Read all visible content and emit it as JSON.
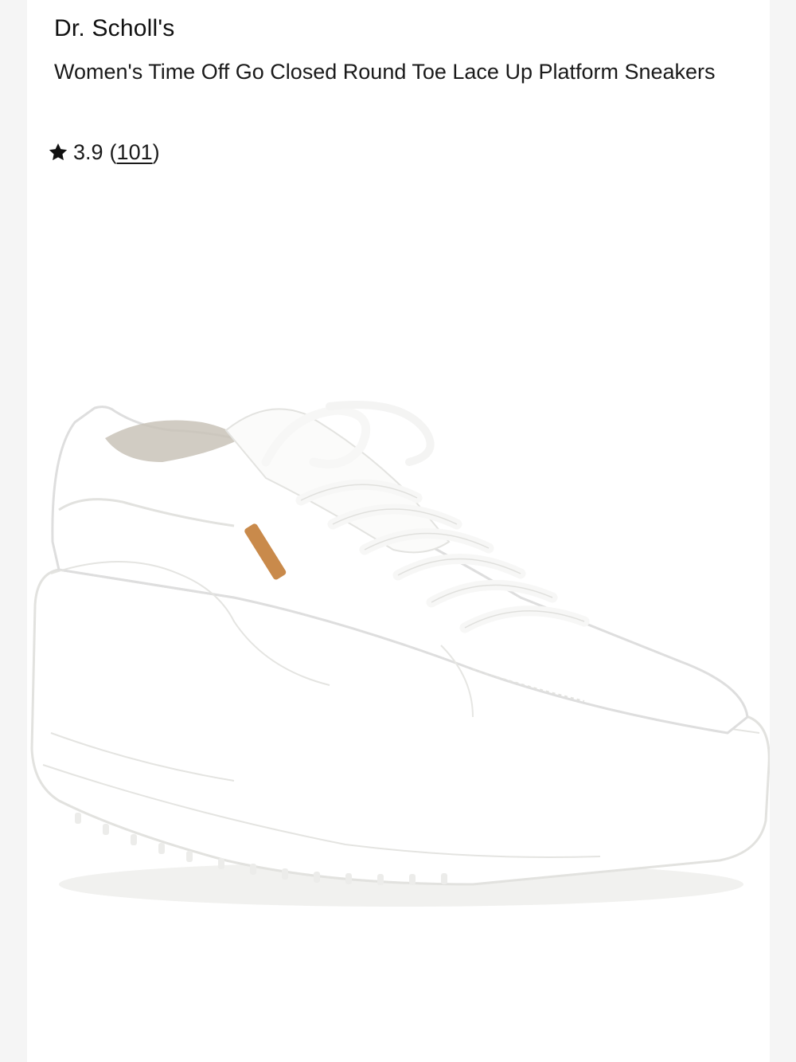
{
  "product": {
    "brand": "Dr. Scholl's",
    "title": "Women's Time Off Go Closed Round Toe Lace Up Platform Sneakers",
    "rating": {
      "value": "3.9",
      "count_open": "(",
      "count": "101",
      "count_close": ")",
      "icon": "star-icon"
    },
    "image": {
      "icon": "sneaker-image",
      "colors": {
        "upper": "#ffffff",
        "shadow": "#e6e6e3",
        "insole": "#c9c3b8",
        "tab": "#c98a4b"
      }
    }
  }
}
